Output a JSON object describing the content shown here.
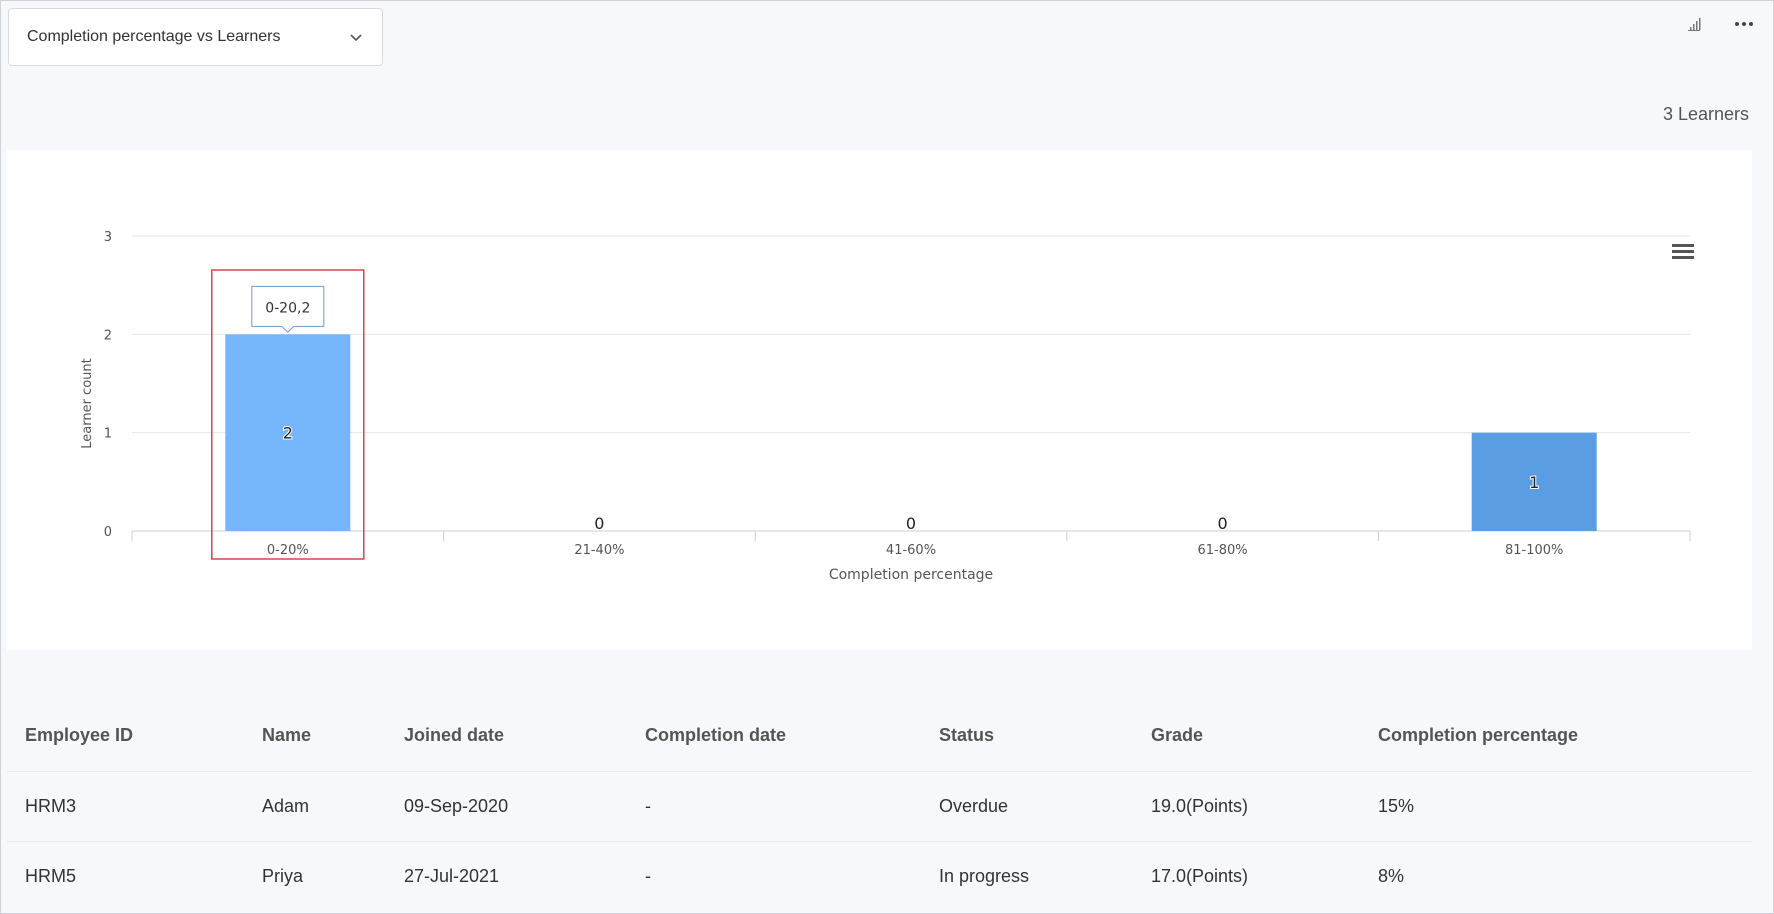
{
  "header": {
    "selector_label": "Completion percentage vs Learners",
    "learner_count": "3 Learners"
  },
  "icons": {
    "chart_icon": "bar-chart-icon",
    "more_icon": "more-options-icon",
    "chart_menu_icon": "hamburger-menu-icon",
    "dropdown_icon": "chevron-down-icon"
  },
  "colors": {
    "bar_primary": "#74b5fc",
    "bar_secondary": "#5a9de3",
    "highlight_box": "#d9444a",
    "tooltip_border": "#6a9bd8"
  },
  "chart_data": {
    "type": "bar",
    "categories": [
      "0-20%",
      "21-40%",
      "41-60%",
      "61-80%",
      "81-100%"
    ],
    "values": [
      2,
      0,
      0,
      0,
      1
    ],
    "xlabel": "Completion percentage",
    "ylabel": "Learner count",
    "ylim": [
      0,
      3
    ],
    "yticks": [
      0,
      1,
      2,
      3
    ],
    "grid": true,
    "tooltip": "0-20,2",
    "highlighted_category": "0-20%"
  },
  "table": {
    "columns": [
      "Employee ID",
      "Name",
      "Joined date",
      "Completion date",
      "Status",
      "Grade",
      "Completion percentage"
    ],
    "rows": [
      [
        "HRM3",
        "Adam",
        "09-Sep-2020",
        "-",
        "Overdue",
        "19.0(Points)",
        "15%"
      ],
      [
        "HRM5",
        "Priya",
        "27-Jul-2021",
        "-",
        "In progress",
        "17.0(Points)",
        "8%"
      ]
    ]
  }
}
